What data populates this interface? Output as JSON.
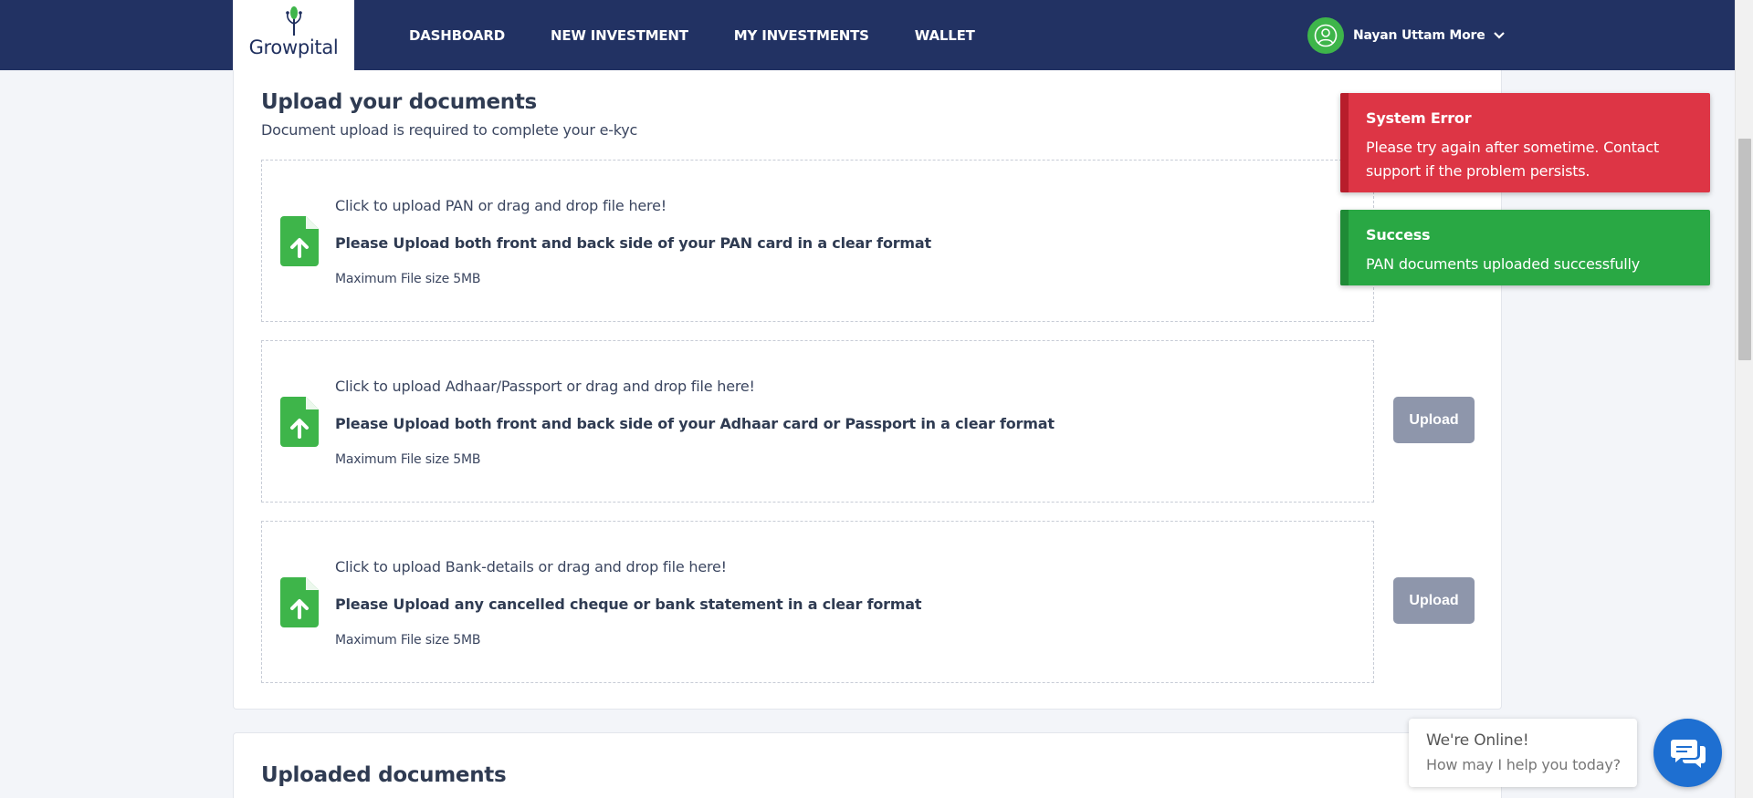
{
  "brand": {
    "name": "Growpital"
  },
  "nav": {
    "links": [
      {
        "label": "DASHBOARD"
      },
      {
        "label": "NEW INVESTMENT"
      },
      {
        "label": "MY INVESTMENTS"
      },
      {
        "label": "WALLET"
      }
    ],
    "user": {
      "name": "Nayan Uttam More",
      "icon": "user-icon"
    }
  },
  "upload_section": {
    "title": "Upload your documents",
    "subtitle": "Document upload is required to complete your e-kyc",
    "items": [
      {
        "prompt": "Click to upload PAN or drag and drop file here!",
        "instruction": "Please Upload both front and back side of your PAN card in a clear format",
        "limit": "Maximum File size 5MB"
      },
      {
        "prompt": "Click to upload Adhaar/Passport or drag and drop file here!",
        "instruction": "Please Upload both front and back side of your Adhaar card or Passport in a clear format",
        "limit": "Maximum File size 5MB",
        "button": "Upload"
      },
      {
        "prompt": "Click to upload Bank-details or drag and drop file here!",
        "instruction": "Please Upload any cancelled cheque or bank statement in a clear format",
        "limit": "Maximum File size 5MB",
        "button": "Upload"
      }
    ]
  },
  "uploaded_section": {
    "title": "Uploaded documents"
  },
  "toasts": {
    "error": {
      "title": "System Error",
      "message": "Please try again after sometime. Contact support if the problem persists.",
      "color": "#dd3545"
    },
    "success": {
      "title": "Success",
      "message": "PAN documents uploaded successfully",
      "color": "#29a844"
    }
  },
  "chat": {
    "line1": "We're Online!",
    "line2": "How may I help you today?",
    "icon": "chat-icon"
  },
  "colors": {
    "navbar": "#223263",
    "accent_green": "#3eb54a",
    "upload_button": "#8e96ab",
    "chat_button": "#1e6fd1"
  }
}
